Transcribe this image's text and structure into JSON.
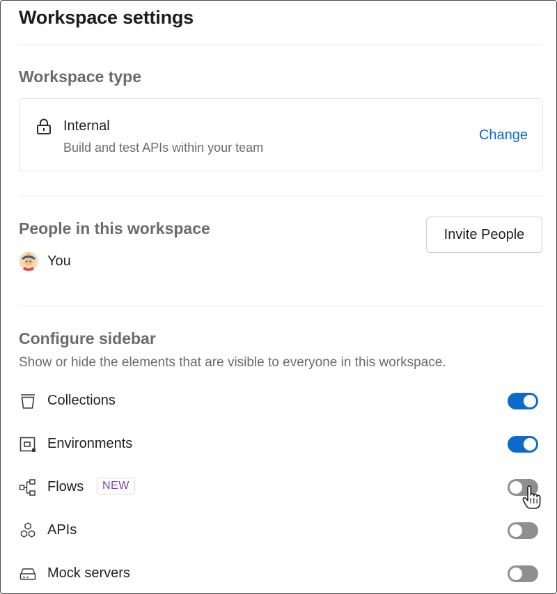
{
  "page": {
    "title": "Workspace settings"
  },
  "workspace_type": {
    "heading": "Workspace type",
    "type_name": "Internal",
    "type_description": "Build and test APIs within your team",
    "change_label": "Change",
    "icon": "lock-icon"
  },
  "people": {
    "heading": "People in this workspace",
    "invite_label": "Invite People",
    "members": [
      {
        "name": "You",
        "icon": "avatar"
      }
    ]
  },
  "sidebar_config": {
    "heading": "Configure sidebar",
    "description": "Show or hide the elements that are visible to everyone in this workspace.",
    "items": [
      {
        "label": "Collections",
        "icon": "collections-icon",
        "enabled": true
      },
      {
        "label": "Environments",
        "icon": "environments-icon",
        "enabled": true
      },
      {
        "label": "Flows",
        "icon": "flows-icon",
        "enabled": false,
        "badge": "NEW"
      },
      {
        "label": "APIs",
        "icon": "apis-icon",
        "enabled": false
      },
      {
        "label": "Mock servers",
        "icon": "mock-servers-icon",
        "enabled": false
      }
    ]
  },
  "colors": {
    "accent": "#0b6bcb",
    "toggle_off": "#8f8f8f",
    "badge_text": "#7b3fae",
    "muted_text": "#6b6b6b"
  }
}
